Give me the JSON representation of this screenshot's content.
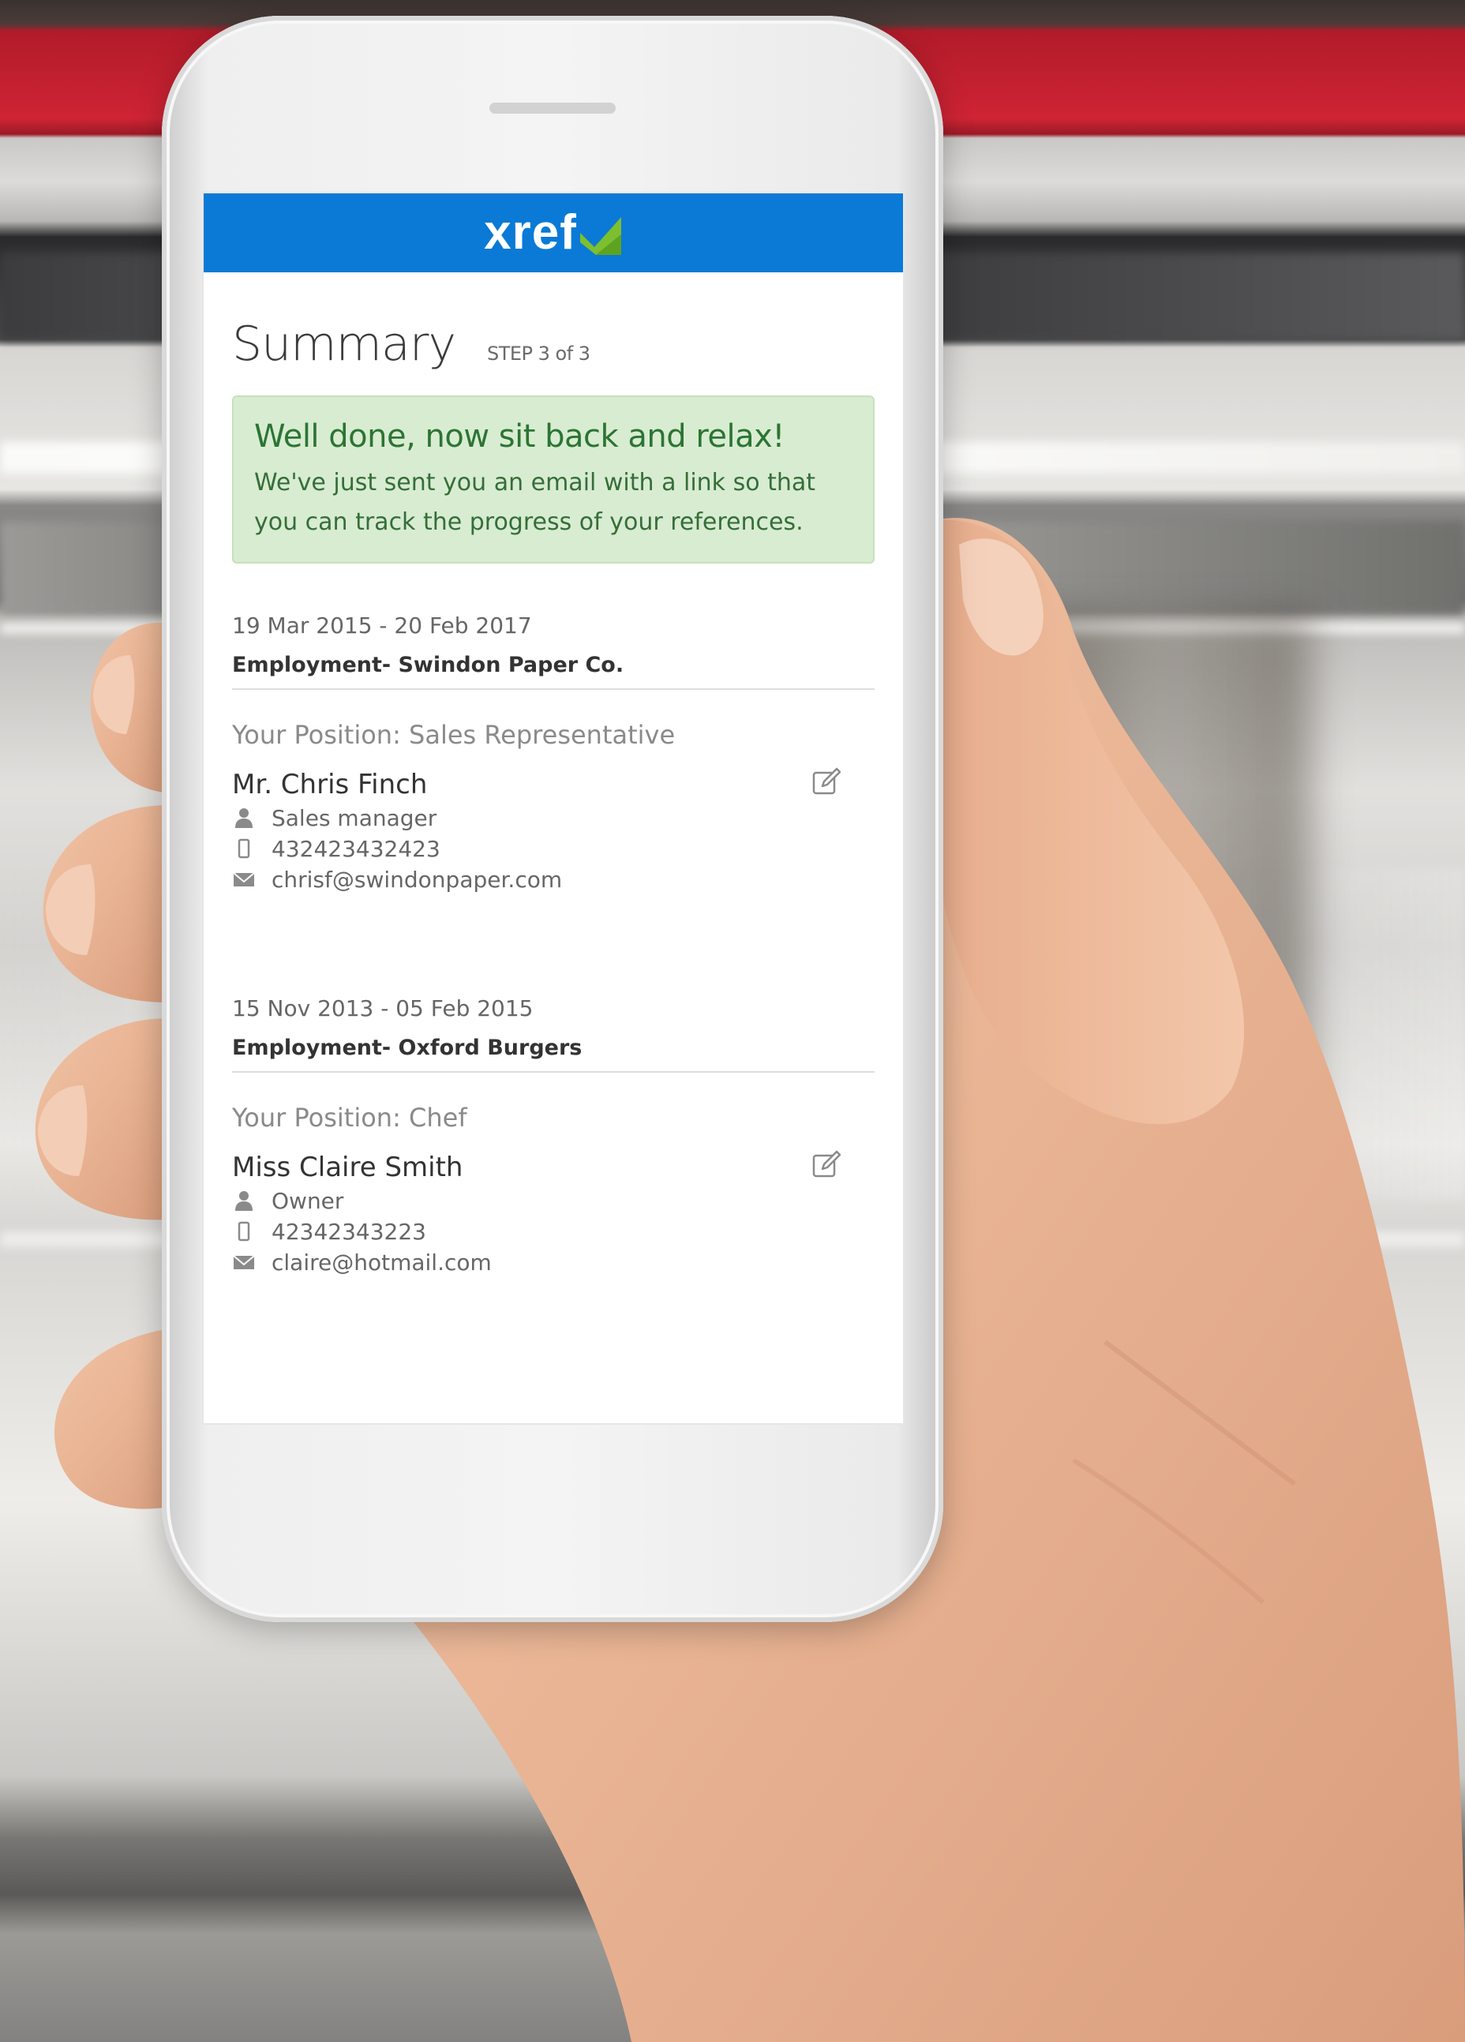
{
  "app": {
    "logo_text": "xref",
    "brand_color": "#0a7ad6",
    "accent_color": "#7dbf2f"
  },
  "page": {
    "title": "Summary",
    "step": "STEP 3 of 3"
  },
  "alert": {
    "title": "Well done, now sit back and relax!",
    "body": "We've just sent you an email with a link so that you can track the progress of your references."
  },
  "entries": [
    {
      "dates": "19 Mar 2015 - 20 Feb 2017",
      "company": "Employment- Swindon Paper Co.",
      "position": "Your Position: Sales Representative",
      "referee": {
        "name": "Mr. Chris Finch",
        "role": "Sales manager",
        "phone": "432423432423",
        "email": "chrisf@swindonpaper.com"
      }
    },
    {
      "dates": "15 Nov 2013 - 05 Feb 2015",
      "company": "Employment- Oxford Burgers",
      "position": "Your Position: Chef",
      "referee": {
        "name": "Miss Claire Smith",
        "role": "Owner",
        "phone": "42342343223",
        "email": "claire@hotmail.com"
      }
    }
  ]
}
